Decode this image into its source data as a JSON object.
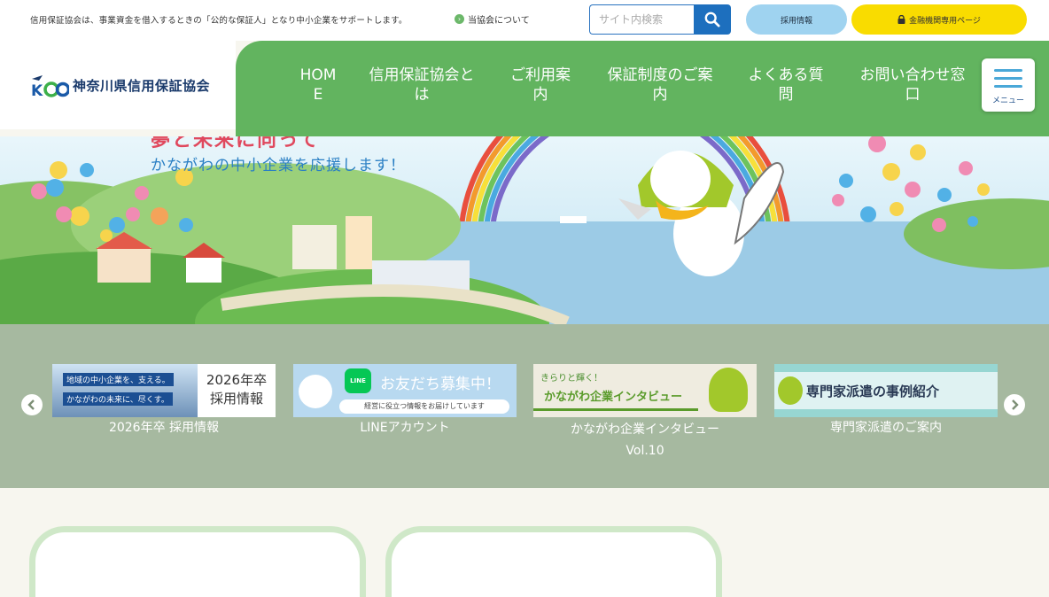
{
  "topbar": {
    "tagline": "信用保証協会は、事業資金を借入するときの「公的な保証人」となり中小企業をサポートします。",
    "about_link": "当協会について",
    "search_placeholder": "サイト内検索",
    "recruit_label": "採用情報",
    "bank_label": "金融機関専用ページ"
  },
  "header": {
    "logo_text": "神奈川県信用保証協会",
    "nav": [
      {
        "line1": "HOM",
        "line2": "E"
      },
      {
        "line1": "信用保証協会と",
        "line2": "は"
      },
      {
        "line1": "ご利用案",
        "line2": "内"
      },
      {
        "line1": "保証制度のご案",
        "line2": "内"
      },
      {
        "line1": "よくある質",
        "line2": "問"
      },
      {
        "line1": "お問い合わせ窓",
        "line2": "口"
      }
    ],
    "menu_label": "メニュー"
  },
  "hero": {
    "title_fragment": "夢と未来に向って",
    "subtitle": "かながわの中小企業を応援します！"
  },
  "banners": [
    {
      "caption": "2026年卒 採用情報",
      "line1": "地域の中小企業を、支える。",
      "line2": "かながわの未来に、尽くす。",
      "side1": "2026年卒",
      "side2": "採用情報"
    },
    {
      "caption": "LINEアカウント",
      "title": "お友だち募集中！",
      "sub": "経営に役立つ情報をお届けしています",
      "line_logo": "LINE"
    },
    {
      "caption": "かながわ企業インタビュー",
      "caption2": "Vol.10",
      "pre": "きらりと輝く！",
      "title": "かながわ企業インタビュー"
    },
    {
      "caption": "専門家派遣のご案内",
      "title": "専門家派遣の事例紹介"
    }
  ],
  "colors": {
    "nav_green": "#62b45f",
    "search_blue": "#1d6fbe",
    "recruit_blue": "#9fd3f0",
    "bank_yellow": "#f9dc00",
    "strip_bg": "#a6b9a0"
  },
  "icons": [
    "search-icon",
    "lock-icon",
    "hamburger-icon",
    "chevron-left-icon",
    "chevron-right-icon"
  ]
}
